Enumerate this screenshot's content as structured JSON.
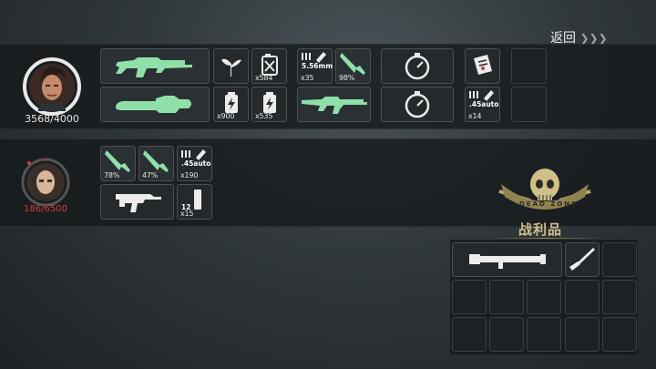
{
  "header": {
    "back_label": "返回",
    "back_arrows": "❯❯❯"
  },
  "colors": {
    "accent_green": "#8fe0a8",
    "hp_red": "#d63c3c",
    "hp_white": "#e8e8e8",
    "loot_gold": "#cfc08a"
  },
  "player1": {
    "hp": "3568/4000",
    "items": {
      "fuel_qty": "x584",
      "battery_qty": "x900",
      "battery2_qty": "x535",
      "ammo556_label": "5.56mm",
      "ammo556_qty": "x35",
      "knife_durability": "98%",
      "ammo45_label": ".45auto",
      "ammo45_qty": "x14"
    }
  },
  "player2": {
    "hp": "186/6500",
    "items": {
      "knife1_durability": "78%",
      "knife2_durability": "47%",
      "ammo45_label": ".45auto",
      "ammo45_qty": "x190",
      "ammo12_label": "12",
      "ammo12_qty": "x15"
    }
  },
  "loot": {
    "title": "战利品",
    "emblem_text": "DEAD ZONE",
    "emblem_icon": "skull-emblem-icon"
  }
}
